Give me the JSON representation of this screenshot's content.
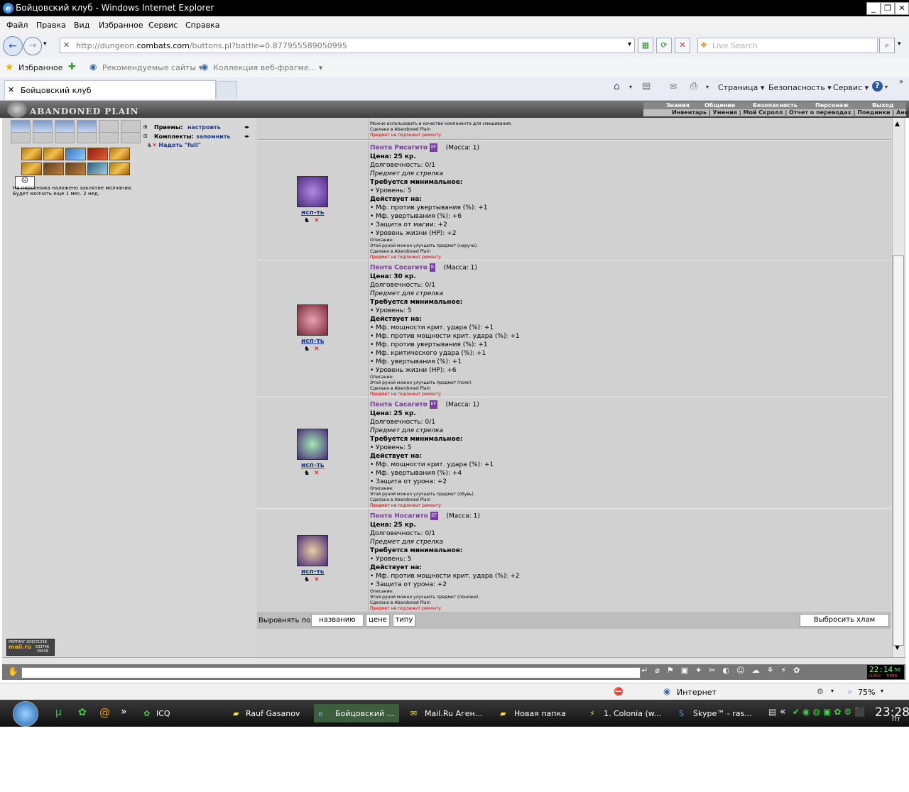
{
  "window": {
    "title": "Бойцовский клуб - Windows Internet Explorer"
  },
  "menu": [
    "Файл",
    "Правка",
    "Вид",
    "Избранное",
    "Сервис",
    "Справка"
  ],
  "address": {
    "prefix": "http://dungeon.",
    "domain": "combats.com",
    "path": "/buttons.pl?battle=0.877955589050995"
  },
  "search": {
    "placeholder": "Live Search"
  },
  "favorites": {
    "label": "Избранное",
    "suggested": "Рекомендуемые сайты ▾",
    "gallery": "Коллекция веб-фрагме... ▾"
  },
  "tab": {
    "title": "Бойцовский клуб"
  },
  "commandbar": {
    "page": "Страница ▾",
    "safety": "Безопасность ▾",
    "tools": "Сервис ▾"
  },
  "game": {
    "location": "ABANDONED PLAIN",
    "topnav": [
      "Знания",
      "Общение",
      "Безопасность",
      "Персонаж",
      "Выход"
    ],
    "subnav": "Инвентарь | Умения | Мой Скролл | Отчет о переводах | Поединки | Анкета",
    "left": {
      "techniques_label": "Приемы:",
      "techniques_link": "настроить",
      "sets_label": "Комплекты:",
      "sets_link": "запомнить",
      "wear_link": "Надеть \"full\"",
      "silence_text": "На персонажа наложено заклятие молчания. Будет молчать еще 1 мес. 2 нед.",
      "rating": {
        "label": "РЕЙТИНГ",
        "v1": "20427123К",
        "v2": "53374K",
        "v3": "39638",
        "brand": "mail.ru"
      }
    },
    "top_partial": {
      "l1": "Можно использовать в качестве компонента для смешивания.",
      "l2": "Сделано в Abandoned Plain",
      "l3": "Предмет не подлежит ремонту"
    },
    "items": [
      {
        "name": "Пента Рисагито",
        "badge": "EF",
        "mass": "(Масса: 1)",
        "price_label": "Цена:",
        "price": "25 кр.",
        "durability": "Долговечность: 0/1",
        "purpose": "Предмет для стрелка",
        "req_label": "Требуется минимальное:",
        "req": "• Уровень: 5",
        "acts_label": "Действует на:",
        "acts": [
          "• Мф. против увертывания (%): +1",
          "• Мф. увертывания (%): +6",
          "• Защита от магии: +2",
          "• Уровень жизни (HP): +2"
        ],
        "d1": "Описание:",
        "d2": "Этой руной можно улучшить предмет (наручи).",
        "d3": "Сделано в Abandoned Plain",
        "d4": "Предмет не подлежит ремонту",
        "use": "исп-ть"
      },
      {
        "name": "Пента Сосагито",
        "badge": "R",
        "mass": "(Масса: 1)",
        "price_label": "Цена:",
        "price": "30 кр.",
        "durability": "Долговечность: 0/1",
        "purpose": "Предмет для стрелка",
        "req_label": "Требуется минимальное:",
        "req": "• Уровень: 5",
        "acts_label": "Действует на:",
        "acts": [
          "• Мф. мощности крит. удара (%): +1",
          "• Мф. против мощности крит. удара (%): +1",
          "• Мф. против увертывания (%): +1",
          "• Мф. критического удара (%): +1",
          "• Мф. увертывания (%): +1",
          "• Уровень жизни (HP): +6"
        ],
        "d1": "Описание:",
        "d2": "Этой руной можно улучшить предмет (пояс).",
        "d3": "Сделано в Abandoned Plain",
        "d4": "Предмет не подлежит ремонту",
        "use": "исп-ть"
      },
      {
        "name": "Пента Сасагито",
        "badge": "EF",
        "mass": "(Масса: 1)",
        "price_label": "Цена:",
        "price": "25 кр.",
        "durability": "Долговечность: 0/1",
        "purpose": "Предмет для стрелка",
        "req_label": "Требуется минимальное:",
        "req": "• Уровень: 5",
        "acts_label": "Действует на:",
        "acts": [
          "• Мф. мощности крит. удара (%): +1",
          "• Мф. увертывания (%): +4",
          "• Защита от урона: +2"
        ],
        "d1": "Описание:",
        "d2": "Этой руной можно улучшить предмет (обувь).",
        "d3": "Сделано в Abandoned Plain",
        "d4": "Предмет не подлежит ремонту",
        "use": "исп-ть"
      },
      {
        "name": "Пента Носагито",
        "badge": "EF",
        "mass": "(Масса: 1)",
        "price_label": "Цена:",
        "price": "25 кр.",
        "durability": "Долговечность: 0/1",
        "purpose": "Предмет для стрелка",
        "req_label": "Требуется минимальное:",
        "req": "• Уровень: 5",
        "acts_label": "Действует на:",
        "acts": [
          "• Мф. против мощности крит. удара (%): +2",
          "• Защита от урона: +2"
        ],
        "d1": "Описание:",
        "d2": "Этой руной можно улучшить предмет (поножи).",
        "d3": "Сделано в Abandoned Plain",
        "d4": "Предмет не подлежит ремонту",
        "use": "исп-ть"
      }
    ],
    "sort": {
      "label": "Выровнять по",
      "by_name": "названию",
      "by_price": "цене",
      "by_type": "типу",
      "drop_junk": "Выбросить хлам"
    },
    "clock": {
      "time": "22:14",
      "sec": "50",
      "clock_label": "CLOCK",
      "timer_label": "TIMER"
    }
  },
  "status": {
    "zone": "Интернет",
    "zoom": "75%"
  },
  "taskbar": {
    "tasks": [
      "ICQ",
      "Rauf Gasanov",
      "Бойцовский ...",
      "Mail.Ru Аген...",
      "Новая папка",
      "1. Colonia (w...",
      "Skype™ - ras..."
    ],
    "time": "23:28",
    "day": "Пт"
  }
}
